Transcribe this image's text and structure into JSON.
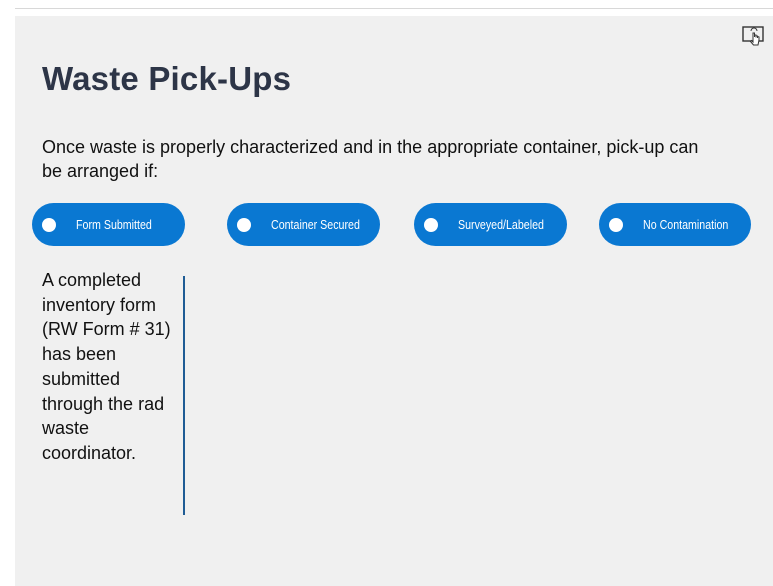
{
  "slide": {
    "title": "Waste Pick-Ups",
    "intro": "Once waste is properly characterized and in the appropriate container, pick-up can be arranged if:",
    "tabs": [
      {
        "label": "Form Submitted"
      },
      {
        "label": "Container Secured"
      },
      {
        "label": "Surveyed/Labeled"
      },
      {
        "label": "No Contamination"
      }
    ],
    "detail": "A completed inventory form (RW Form # 31) has been submitted through the rad waste coordinator."
  },
  "icons": {
    "touch": "touch-tap-icon"
  },
  "colors": {
    "background": "#f0f0f0",
    "title": "#2d3547",
    "tab_fill": "#0a78d2",
    "divider": "#1f5c95"
  }
}
